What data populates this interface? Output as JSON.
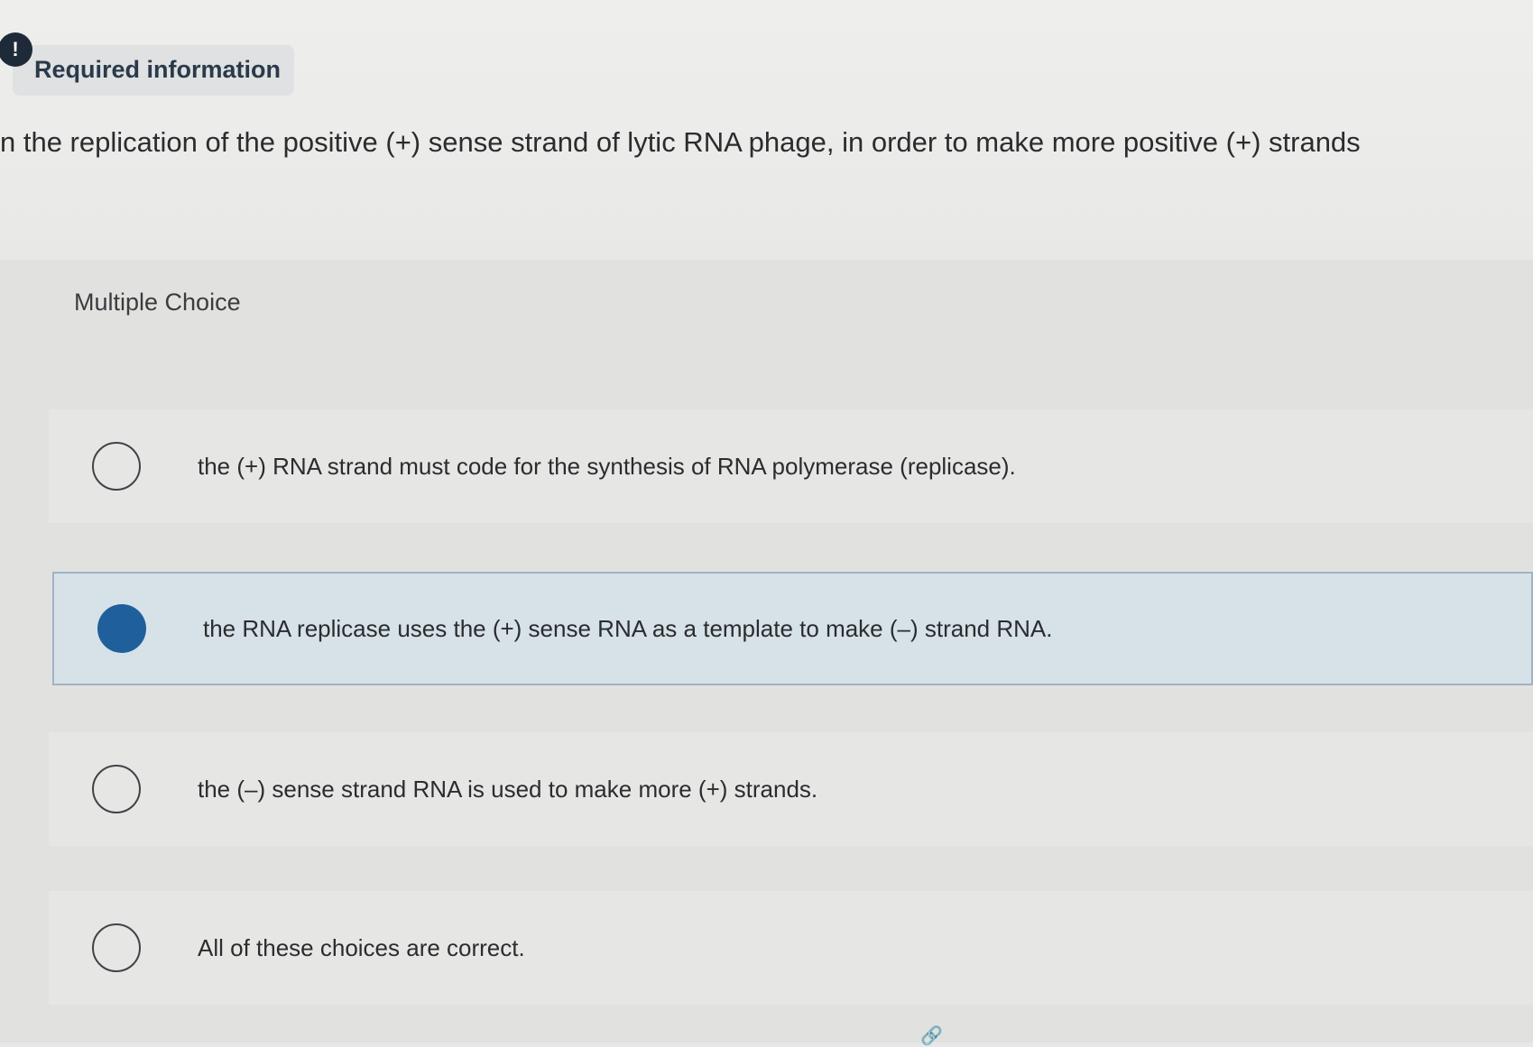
{
  "header": {
    "alert_glyph": "!",
    "required_label": "Required information"
  },
  "question": {
    "text": "n the replication of the positive (+) sense strand of lytic RNA phage, in order to make more positive (+) strands"
  },
  "section": {
    "label": "Multiple Choice"
  },
  "options": [
    {
      "label": "the (+) RNA strand must code for the synthesis of RNA polymerase (replicase).",
      "selected": false
    },
    {
      "label": "the RNA replicase uses the (+) sense RNA as a template to make (–) strand RNA.",
      "selected": true
    },
    {
      "label": "the (–) sense strand RNA is used to make more (+) strands.",
      "selected": false
    },
    {
      "label": "All of these choices are correct.",
      "selected": false
    }
  ],
  "colors": {
    "selected_radio": "#1f5f9c",
    "selected_row": "#d7e1e8",
    "badge": "#1f2a38"
  },
  "icons": {
    "alert": "alert-icon",
    "link": "link-icon"
  }
}
